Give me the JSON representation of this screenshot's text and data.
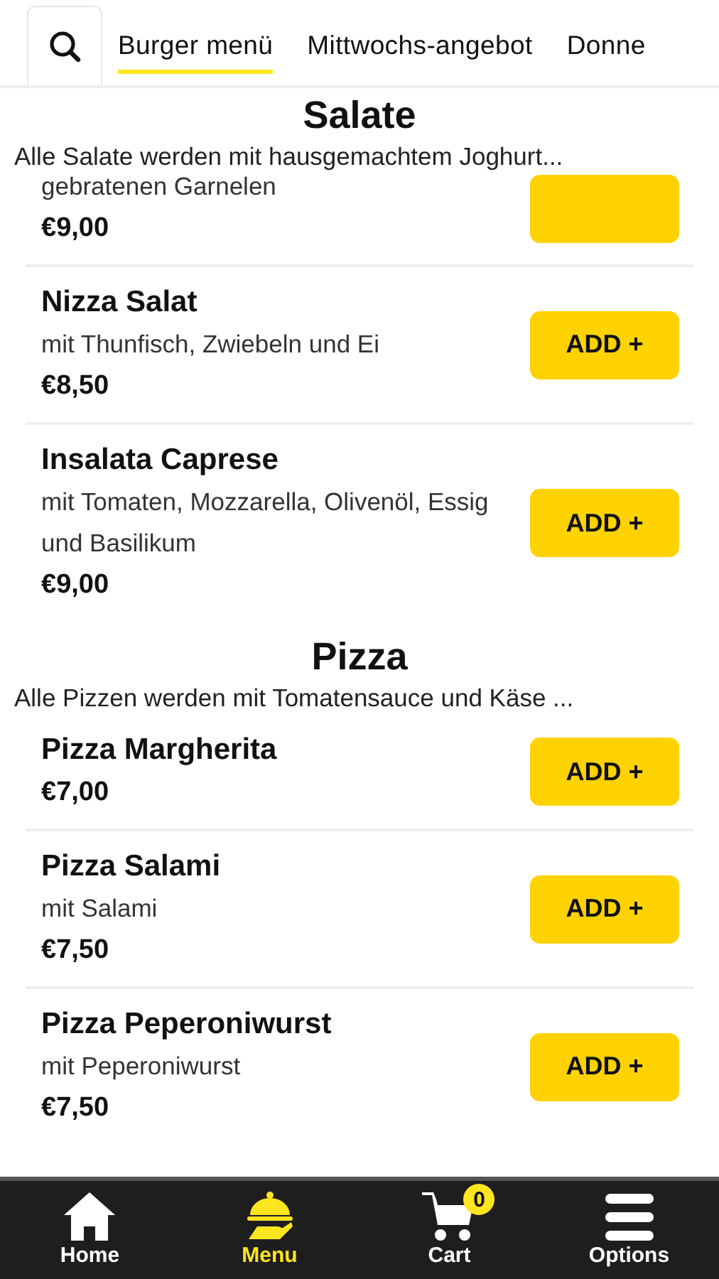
{
  "tabs": [
    {
      "label": "Burger menü",
      "selected": true
    },
    {
      "label": "Mittwochs-angebot",
      "selected": false
    },
    {
      "label": "Donne",
      "selected": false
    }
  ],
  "sections": [
    {
      "title": "Salate",
      "description": "Alle Salate werden mit hausgemachtem Joghurt...",
      "items": [
        {
          "clipped_top": true,
          "description": "gebratenen Garnelen",
          "price": "€9,00"
        },
        {
          "name": "Nizza Salat",
          "description": "mit Thunfisch, Zwiebeln und Ei",
          "price": "€8,50",
          "button": "ADD +"
        },
        {
          "name": "Insalata Caprese",
          "description": "mit Tomaten, Mozzarella, Olivenöl, Essig und Basilikum",
          "price": "€9,00",
          "button": "ADD +"
        }
      ]
    },
    {
      "title": "Pizza",
      "description": "Alle Pizzen werden mit Tomatensauce und Käse ...",
      "items": [
        {
          "name": "Pizza Margherita",
          "price": "€7,00",
          "button": "ADD +"
        },
        {
          "name": "Pizza Salami",
          "description": "mit Salami",
          "price": "€7,50",
          "button": "ADD +"
        },
        {
          "name": "Pizza Peperoniwurst",
          "description": "mit Peperoniwurst",
          "price": "€7,50",
          "button": "ADD +"
        }
      ]
    }
  ],
  "nav": [
    {
      "kind": "home",
      "label": "Home",
      "selected": false
    },
    {
      "kind": "menu",
      "label": "Menu",
      "selected": true
    },
    {
      "kind": "cart",
      "label": "Cart",
      "selected": false,
      "badge": "0"
    },
    {
      "kind": "options",
      "label": "Options",
      "selected": false
    }
  ]
}
